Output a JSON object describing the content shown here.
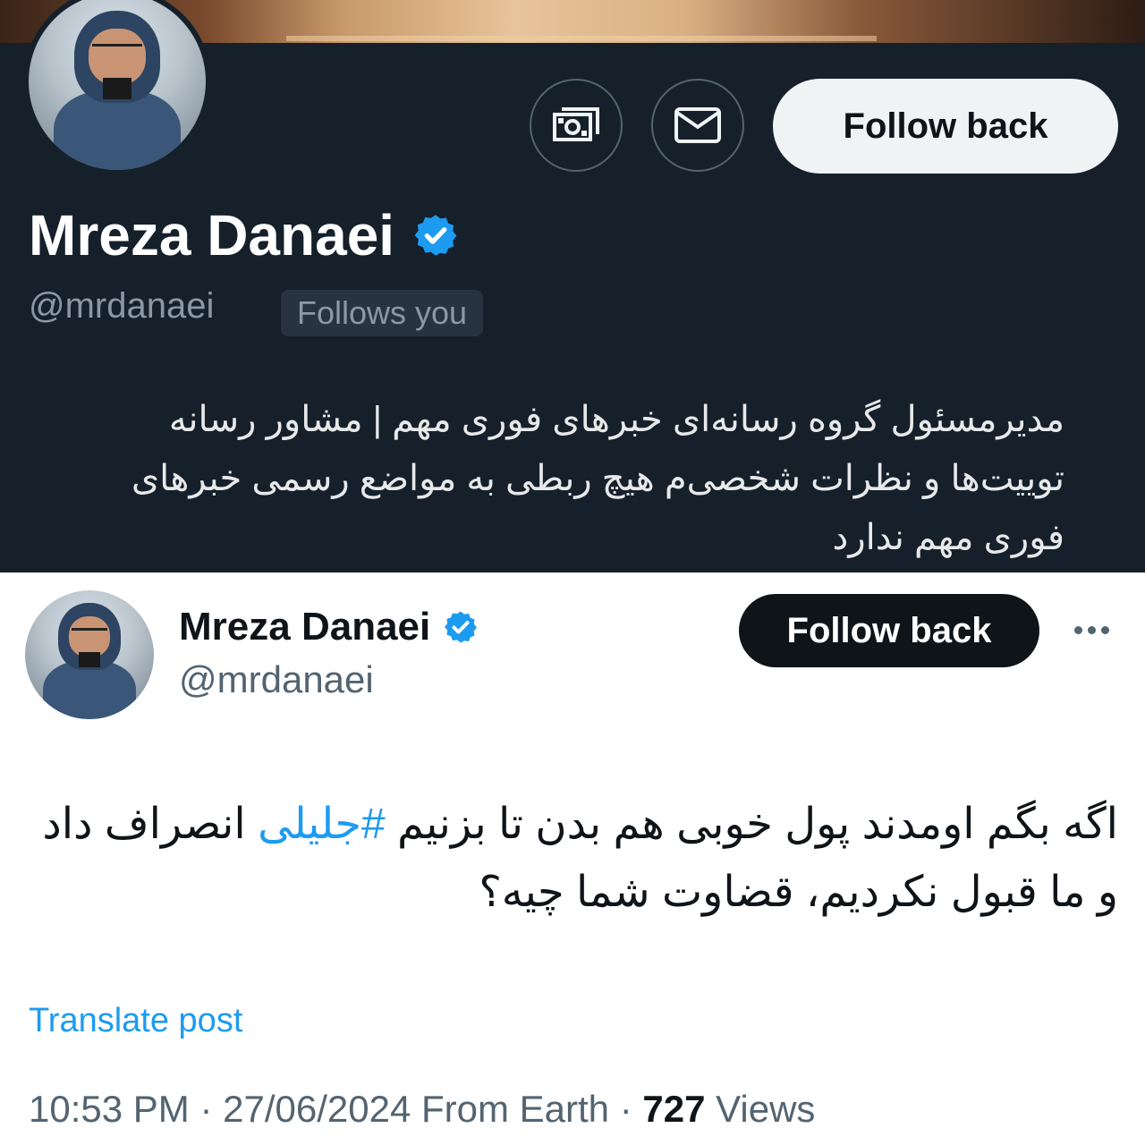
{
  "profile": {
    "name": "Mreza Danaei",
    "handle": "@mrdanaei",
    "follows_you": "Follows you",
    "follow_back_label": "Follow back",
    "bio_lines": [
      "مدیرمسئول گروه رسانه‌ای خبرهای فوری مهم | مشاور رسانه",
      "توییت‌ها و نظرات شخصی‌م هیچ ربطی به مواضع رسمی خبرهای",
      "فوری مهم ندارد"
    ]
  },
  "tweet": {
    "name": "Mreza Danaei",
    "handle": "@mrdanaei",
    "follow_back_label": "Follow back",
    "text_before_hashtag": "اگه بگم اومدند پول خوبی هم بدن تا بزنیم ",
    "hashtag": "#جلیلی",
    "text_after_hashtag": " انصراف داد و ما قبول نکردیم، قضاوت شما چیه؟",
    "translate_label": "Translate post",
    "time": "10:53 PM",
    "date": "27/06/2024",
    "source": "From Earth",
    "views_count": "727",
    "views_label": "Views",
    "separator": " · "
  },
  "colors": {
    "dark_bg": "#15202b",
    "verified_blue": "#1d9bf0",
    "link_blue": "#1d9bf0",
    "muted_gray": "#536471"
  },
  "icons": {
    "tip": "money-tip-icon",
    "message": "envelope-icon",
    "verified": "verified-badge-icon",
    "more": "more-dots-icon"
  }
}
